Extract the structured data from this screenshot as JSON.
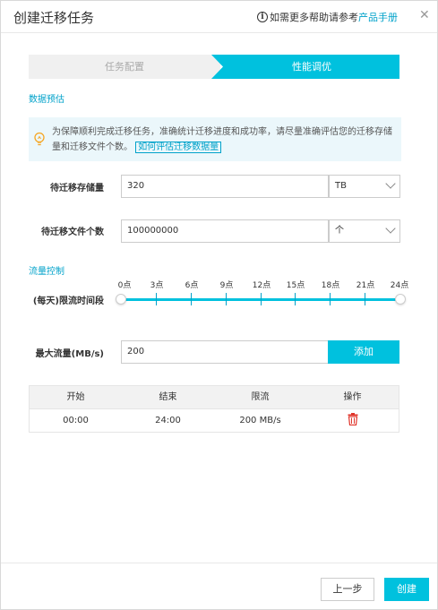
{
  "dialog": {
    "title": "创建迁移任务",
    "help_text": "如需更多帮助请参考",
    "help_link": "产品手册",
    "close_glyph": "✕"
  },
  "steps": [
    {
      "label": "任务配置",
      "active": false
    },
    {
      "label": "性能调优",
      "active": true
    }
  ],
  "data_estimate": {
    "section_title": "数据预估",
    "tip_text": "为保障顺利完成迁移任务，准确统计迁移进度和成功率，请尽量准确评估您的迁移存储量和迁移文件个数。",
    "tip_link": "如何评估迁移数据量",
    "storage_label": "待迁移存储量",
    "storage_value": "320",
    "storage_unit": "TB",
    "files_label": "待迁移文件个数",
    "files_value": "100000000",
    "files_unit": "个"
  },
  "flow_control": {
    "section_title": "流量控制",
    "period_label": "(每天)限流时间段",
    "hour_ticks": [
      "0点",
      "3点",
      "6点",
      "9点",
      "12点",
      "15点",
      "18点",
      "21点",
      "24点"
    ],
    "range_start_hour": 0,
    "range_end_hour": 24,
    "max_flow_label": "最大流量(MB/s)",
    "max_flow_value": "200",
    "add_button": "添加"
  },
  "table": {
    "headers": [
      "开始",
      "结束",
      "限流",
      "操作"
    ],
    "rows": [
      {
        "start": "00:00",
        "end": "24:00",
        "limit": "200 MB/s"
      }
    ]
  },
  "footer": {
    "prev_button": "上一步",
    "create_button": "创建"
  },
  "colors": {
    "accent": "#00c1de",
    "link": "#00a2ca",
    "delete": "#e0352b"
  },
  "icons": {
    "help": "info-icon",
    "tip": "lightbulb-icon",
    "delete": "trash-icon",
    "close": "close-icon",
    "dropdown": "chevron-down-icon"
  }
}
